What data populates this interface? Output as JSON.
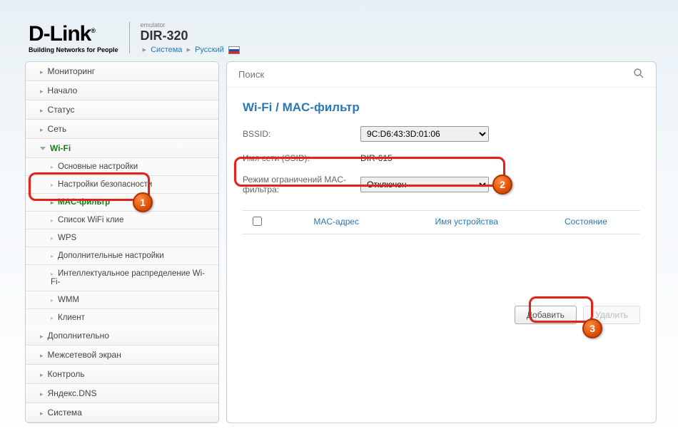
{
  "header": {
    "brand": "D-Link",
    "reg": "®",
    "tagline": "Building Networks for People",
    "emulator": "emulator",
    "model": "DIR-320",
    "crumb_system": "Система",
    "crumb_lang": "Русский"
  },
  "search": {
    "placeholder": "Поиск"
  },
  "sidebar": {
    "items": [
      "Мониторинг",
      "Начало",
      "Статус",
      "Сеть",
      "Wi-Fi",
      "Дополнительно",
      "Межсетевой экран",
      "Контроль",
      "Яндекс.DNS",
      "Система"
    ],
    "wifi_sub": [
      "Основные настройки",
      "Настройки безопасности",
      "MAC-фильтр",
      "Список WiFi клие",
      "WPS",
      "Дополнительные настройки",
      "Интеллектуальное распределение Wi-Fi-",
      "WMM",
      "Клиент"
    ]
  },
  "page": {
    "title_part1": "Wi-Fi",
    "title_sep": " / ",
    "title_part2": "MAC-фильтр",
    "bssid_label": "BSSID:",
    "bssid_value": "9C:D6:43:3D:01:06",
    "ssid_label": "Имя сети (SSID):",
    "ssid_value": "DIR-615",
    "mode_label": "Режим ограничений MAC-фильтра:",
    "mode_value": "Отключен"
  },
  "table": {
    "col_mac": "MAC-адрес",
    "col_device": "Имя устройства",
    "col_state": "Состояние"
  },
  "buttons": {
    "add": "Добавить",
    "delete": "Удалить"
  },
  "annotations": {
    "b1": "1",
    "b2": "2",
    "b3": "3"
  }
}
